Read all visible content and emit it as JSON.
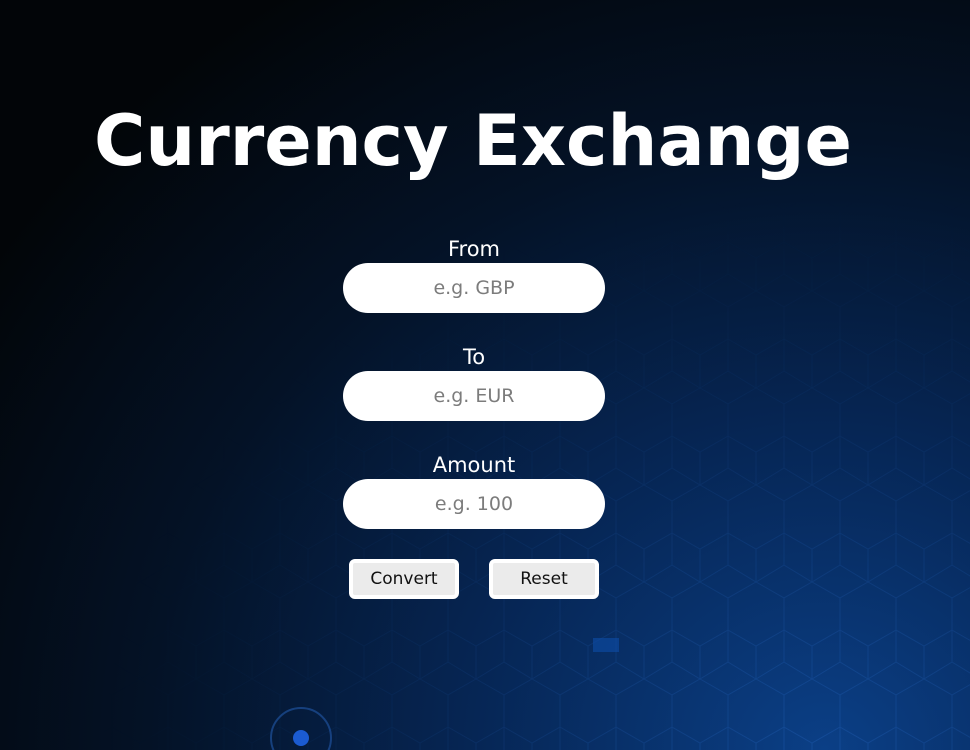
{
  "title": "Currency Exchange",
  "form": {
    "from": {
      "label": "From",
      "placeholder": "e.g. GBP",
      "value": ""
    },
    "to": {
      "label": "To",
      "placeholder": "e.g. EUR",
      "value": ""
    },
    "amount": {
      "label": "Amount",
      "placeholder": "e.g. 100",
      "value": ""
    }
  },
  "buttons": {
    "convert_label": "Convert",
    "reset_label": "Reset"
  },
  "colors": {
    "background_dark": "#020508",
    "background_blue": "#0b3f86",
    "text": "#ffffff",
    "input_bg": "#ffffff",
    "button_bg": "#ebebeb"
  }
}
